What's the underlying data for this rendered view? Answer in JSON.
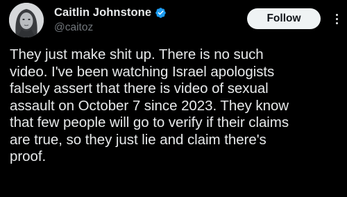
{
  "author": {
    "display_name": "Caitlin Johnstone",
    "handle": "@caitoz",
    "verified_icon": "verified-badge-icon",
    "verified_color": "#1d9bf0"
  },
  "actions": {
    "follow_label": "Follow",
    "more_icon": "more-vertical-icon"
  },
  "tweet": {
    "text": "They just make shit up. There is no such\nvideo. I've been watching Israel apologists\nfalsely assert that there is video of sexual\nassault on October 7 since 2023. They know\nthat few people will go to verify if their claims\nare true, so they just lie and claim there's\nproof."
  },
  "colors": {
    "background": "#000000",
    "text_primary": "#e7e9ea",
    "text_secondary": "#71767b",
    "follow_bg": "#eff3f4",
    "follow_text": "#0f1419"
  }
}
